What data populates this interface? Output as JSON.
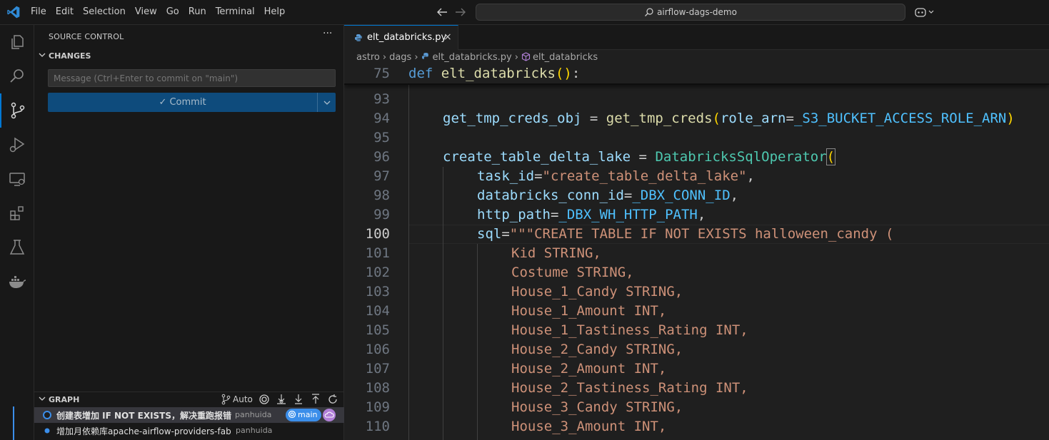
{
  "titlebar": {
    "menu": [
      "File",
      "Edit",
      "Selection",
      "View",
      "Go",
      "Run",
      "Terminal",
      "Help"
    ],
    "search_text": "airflow-dags-demo"
  },
  "activity_icons": [
    "explorer-icon",
    "search-icon",
    "source-control-icon",
    "run-debug-icon",
    "remote-explorer-icon",
    "extensions-icon",
    "testing-icon",
    "docker-icon"
  ],
  "sidebar": {
    "title": "SOURCE CONTROL",
    "more": "···",
    "changes_label": "CHANGES",
    "message_placeholder": "Message (Ctrl+Enter to commit on \"main\")",
    "commit_label": "✓ Commit",
    "graph": {
      "title": "GRAPH",
      "auto_label": "Auto",
      "commits": [
        {
          "message": "创建表增加 IF NOT EXISTS，解决重跑报错",
          "author": "panhuida",
          "branch": "main"
        },
        {
          "message": "增加月依赖库apache-airflow-providers-fab",
          "author": "panhuida"
        }
      ]
    }
  },
  "editor": {
    "tab_label": "elt_databricks.py",
    "tab_close": "×",
    "breadcrumb": [
      "astro",
      "dags",
      "elt_databricks.py",
      "elt_databricks"
    ],
    "sticky": {
      "ln": "75",
      "def": "def",
      "name": "elt_databricks",
      "open": "(",
      "close": ")",
      "colon": ":"
    },
    "current_line": "100",
    "lines": [
      {
        "ln": "93"
      },
      {
        "ln": "94",
        "a": "get_tmp_creds_obj",
        "b": " = ",
        "c": "get_tmp_creds",
        "d": "(",
        "e": "role_arn",
        "f": "=",
        "g": "_S3_BUCKET_ACCESS_ROLE_ARN",
        "h": ")"
      },
      {
        "ln": "95"
      },
      {
        "ln": "96",
        "a": "create_table_delta_lake",
        "b": " = ",
        "c": "DatabricksSqlOperator",
        "d": "("
      },
      {
        "ln": "97",
        "a": "task_id",
        "b": "=",
        "c": "\"create_table_delta_lake\"",
        "d": ","
      },
      {
        "ln": "98",
        "a": "databricks_conn_id",
        "b": "=",
        "c": "_DBX_CONN_ID",
        "d": ","
      },
      {
        "ln": "99",
        "a": "http_path",
        "b": "=",
        "c": "_DBX_WH_HTTP_PATH",
        "d": ","
      },
      {
        "ln": "100",
        "a": "sql",
        "b": "=",
        "c": "\"\"\"CREATE TABLE IF NOT EXISTS halloween_candy ("
      },
      {
        "ln": "101",
        "s": "Kid STRING,"
      },
      {
        "ln": "102",
        "s": "Costume STRING,"
      },
      {
        "ln": "103",
        "s": "House_1_Candy STRING,"
      },
      {
        "ln": "104",
        "s": "House_1_Amount INT,"
      },
      {
        "ln": "105",
        "s": "House_1_Tastiness_Rating INT,"
      },
      {
        "ln": "106",
        "s": "House_2_Candy STRING,"
      },
      {
        "ln": "107",
        "s": "House_2_Amount INT,"
      },
      {
        "ln": "108",
        "s": "House_2_Tastiness_Rating INT,"
      },
      {
        "ln": "109",
        "s": "House_3_Candy STRING,"
      },
      {
        "ln": "110",
        "s": "House_3_Amount INT,"
      }
    ]
  }
}
